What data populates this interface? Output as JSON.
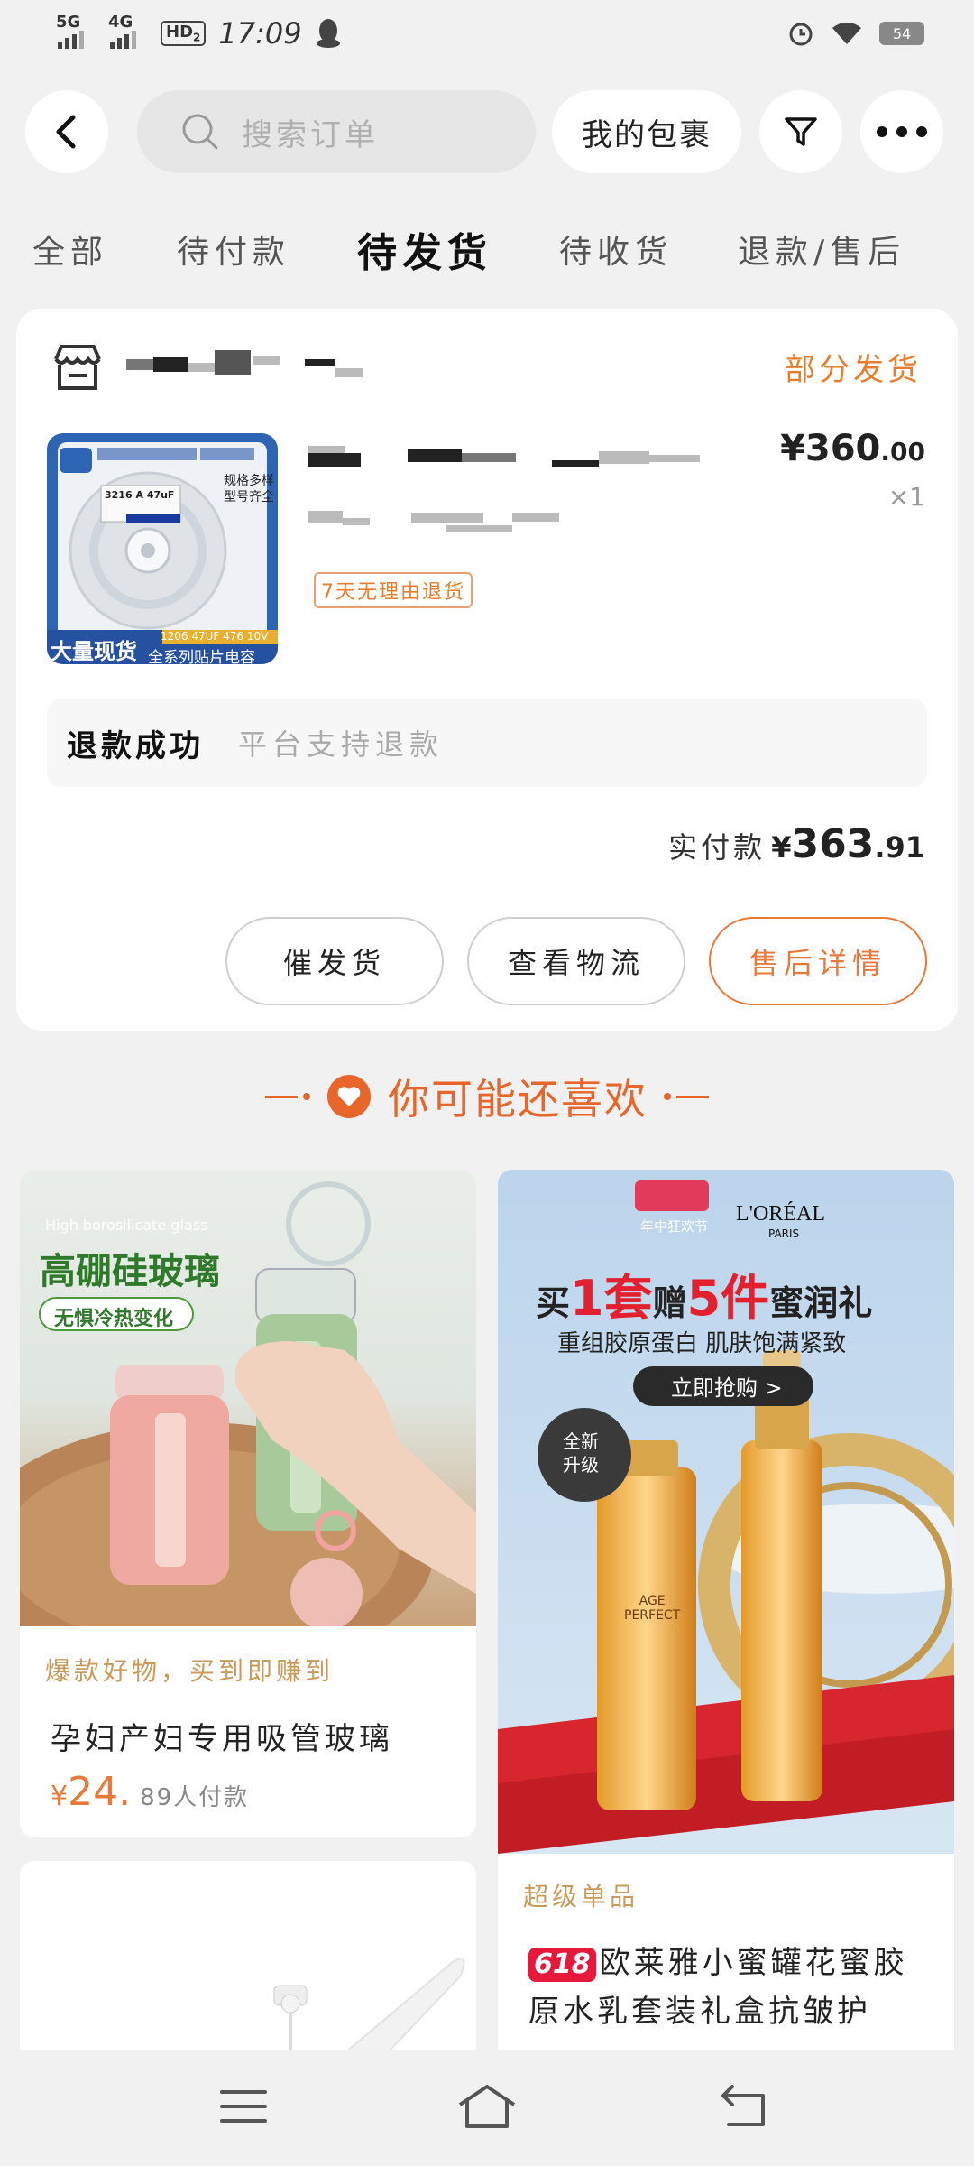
{
  "status_bar": {
    "net1": "5G",
    "net2": "4G",
    "hd": "HD",
    "hd_sub": "2",
    "time": "17:09",
    "battery": "54"
  },
  "header": {
    "search_placeholder": "搜索订单",
    "package_label": "我的包裹"
  },
  "tabs": [
    "全部",
    "待付款",
    "待发货",
    "待收货",
    "退款/售后"
  ],
  "active_tab": "待发货",
  "order": {
    "status": "部分发货",
    "thumb": {
      "label": "3216 A 47uF",
      "side": "规格多样\n型号齐全",
      "banner_left": "大量现货",
      "banner_right_top": "1206 47UF 476 10V",
      "banner_right_bottom": "全系列贴片电容"
    },
    "price_int": "¥360",
    "price_dec": ".00",
    "quantity": "×1",
    "return_tag": "7天无理由退货",
    "refund_status": "退款成功",
    "refund_note": "平台支持退款",
    "paid_label": "实付款",
    "paid_currency": "¥",
    "paid_int": "363",
    "paid_dec": ".91",
    "buttons": [
      "催发货",
      "查看物流",
      "售后详情"
    ]
  },
  "recommend": {
    "title": "你可能还喜欢",
    "products": [
      {
        "image_en": "High borosilicate glass",
        "image_title": "高硼硅玻璃",
        "image_badge": "无惧冷热变化",
        "tag": "爆款好物，买到即赚到",
        "title": "孕妇产妇专用吸管玻璃",
        "price_currency": "¥",
        "price": "24.",
        "sales": "89人付款"
      },
      {
        "ad_brand": "L'ORÉAL",
        "ad_brand_sub": "PARIS",
        "ad_event": "年中狂欢节",
        "ad_headline_pre": "买",
        "ad_headline_num1": "1套",
        "ad_headline_mid": "赠",
        "ad_headline_num2": "5件",
        "ad_headline_post": "蜜润礼",
        "ad_sub": "重组胶原蛋白",
        "ad_sub2": "肌肤饱满紧致",
        "ad_cta": "立即抢购 >",
        "ad_badge": "全新\n升级",
        "ad_bottle_label": "AGE\nPERFECT",
        "tag": "超级单品",
        "badge": "618",
        "title_line1": "欧莱雅小蜜罐花蜜胶",
        "title_line2": "原水乳套装礼盒抗皱护"
      }
    ]
  }
}
